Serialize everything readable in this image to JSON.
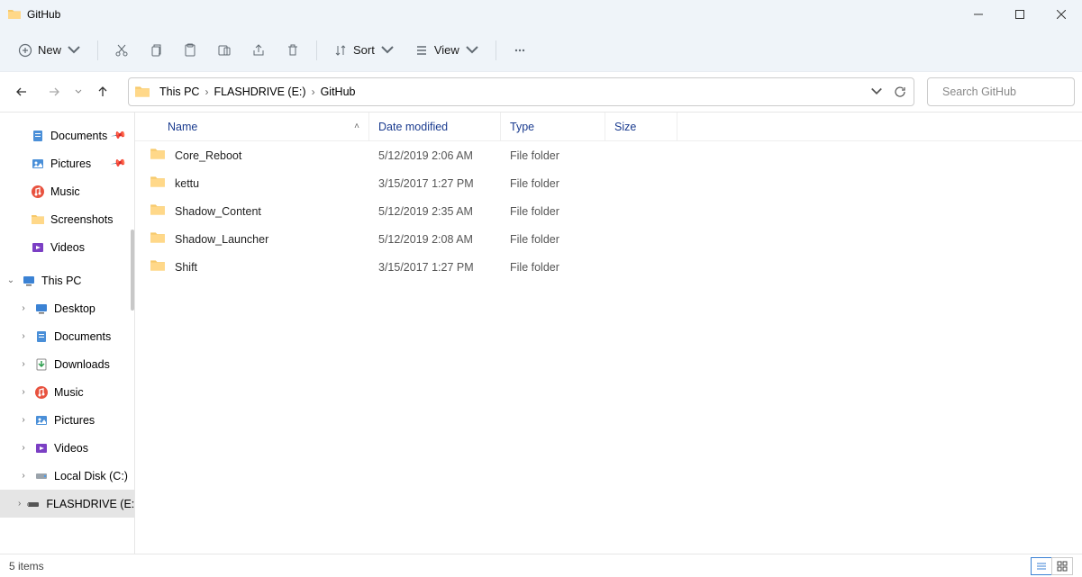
{
  "window": {
    "title": "GitHub"
  },
  "toolbar": {
    "new": "New",
    "sort": "Sort",
    "view": "View"
  },
  "breadcrumb": [
    "This PC",
    "FLASHDRIVE (E:)",
    "GitHub"
  ],
  "search": {
    "placeholder": "Search GitHub"
  },
  "sidebar": {
    "quick": [
      {
        "label": "Documents",
        "icon": "doc",
        "pinned": true
      },
      {
        "label": "Pictures",
        "icon": "pic",
        "pinned": true
      },
      {
        "label": "Music",
        "icon": "music",
        "pinned": false
      },
      {
        "label": "Screenshots",
        "icon": "folder",
        "pinned": false
      },
      {
        "label": "Videos",
        "icon": "video",
        "pinned": false
      }
    ],
    "thispc": {
      "label": "This PC",
      "expanded": true
    },
    "thispc_children": [
      {
        "label": "Desktop",
        "icon": "desktop"
      },
      {
        "label": "Documents",
        "icon": "doc"
      },
      {
        "label": "Downloads",
        "icon": "down"
      },
      {
        "label": "Music",
        "icon": "music"
      },
      {
        "label": "Pictures",
        "icon": "pic"
      },
      {
        "label": "Videos",
        "icon": "video"
      },
      {
        "label": "Local Disk (C:)",
        "icon": "disk"
      },
      {
        "label": "FLASHDRIVE (E:)",
        "icon": "usb",
        "selected": true
      }
    ]
  },
  "columns": {
    "name": "Name",
    "date": "Date modified",
    "type": "Type",
    "size": "Size"
  },
  "items": [
    {
      "name": "Core_Reboot",
      "date": "5/12/2019 2:06 AM",
      "type": "File folder"
    },
    {
      "name": "kettu",
      "date": "3/15/2017 1:27 PM",
      "type": "File folder"
    },
    {
      "name": "Shadow_Content",
      "date": "5/12/2019 2:35 AM",
      "type": "File folder"
    },
    {
      "name": "Shadow_Launcher",
      "date": "5/12/2019 2:08 AM",
      "type": "File folder"
    },
    {
      "name": "Shift",
      "date": "3/15/2017 1:27 PM",
      "type": "File folder"
    }
  ],
  "status": {
    "count": "5 items"
  }
}
